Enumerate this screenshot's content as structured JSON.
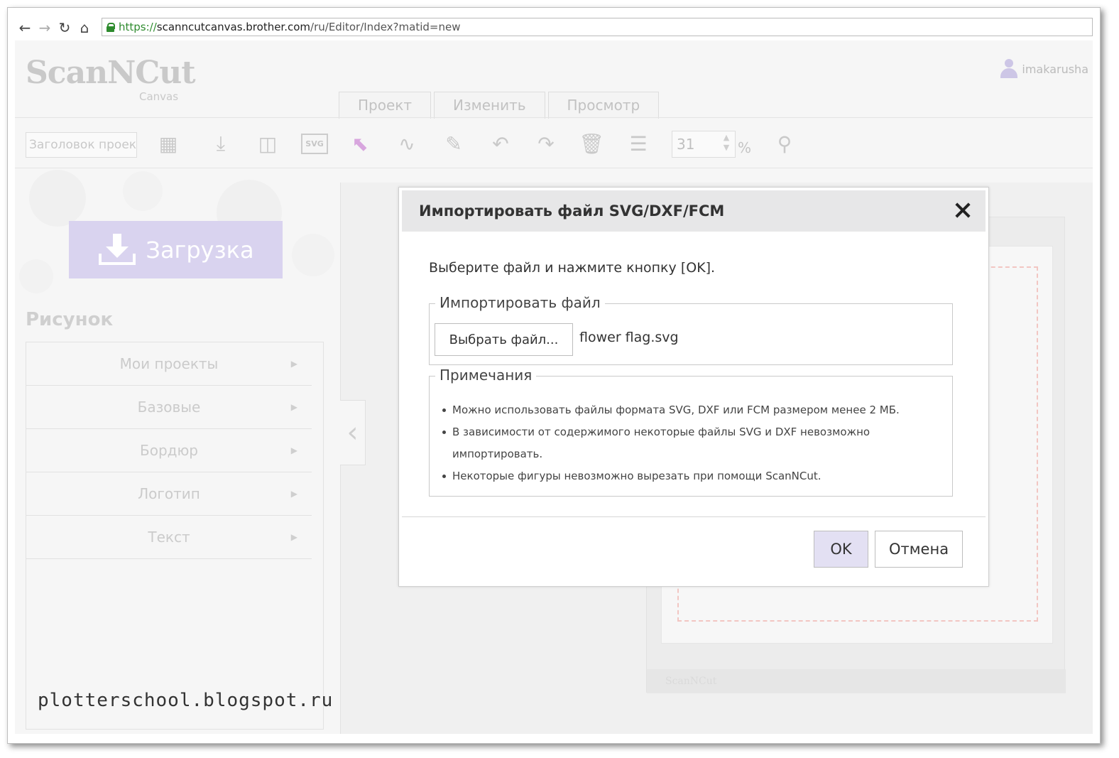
{
  "browser": {
    "url_protocol": "https://",
    "url_host": "scanncutcanvas.brother.com",
    "url_path": "/ru/Editor/Index?matid=new"
  },
  "app": {
    "logo_text": "ScanNCut",
    "logo_sub": "Canvas",
    "username": "imakarusha",
    "tabs": [
      {
        "label": "Проект"
      },
      {
        "label": "Изменить"
      },
      {
        "label": "Просмотр"
      }
    ],
    "toolbar": {
      "title_placeholder": "Заголовок проекта",
      "svg_badge": "SVG",
      "zoom_value": "31",
      "zoom_unit": "%"
    },
    "sidebar": {
      "upload_label": "Загрузка",
      "section_title": "Рисунок",
      "categories": [
        {
          "label": "Мои проекты"
        },
        {
          "label": "Базовые"
        },
        {
          "label": "Бордюр"
        },
        {
          "label": "Логотип"
        },
        {
          "label": "Текст"
        }
      ]
    },
    "mat_footer": "ScanNCut"
  },
  "modal": {
    "title": "Импортировать файл SVG/DXF/FCM",
    "instruction": "Выберите файл и нажмите кнопку [OK].",
    "import_legend": "Импортировать файл",
    "choose_label": "Выбрать файл...",
    "file_name": "flower flag.svg",
    "notes_legend": "Примечания",
    "notes": [
      "Можно использовать файлы формата SVG, DXF или FCM размером менее 2 МБ.",
      "В зависимости от содержимого некоторые файлы SVG и DXF невозможно импортировать.",
      "Некоторые фигуры невозможно вырезать при помощи ScanNCut."
    ],
    "ok_label": "OK",
    "cancel_label": "Отмена"
  },
  "watermark": "plotterschool.blogspot.ru",
  "colors": {
    "accent": "#d9d3ef",
    "ok_button": "#e3e0f3",
    "secure_green": "#2e8b2e"
  }
}
